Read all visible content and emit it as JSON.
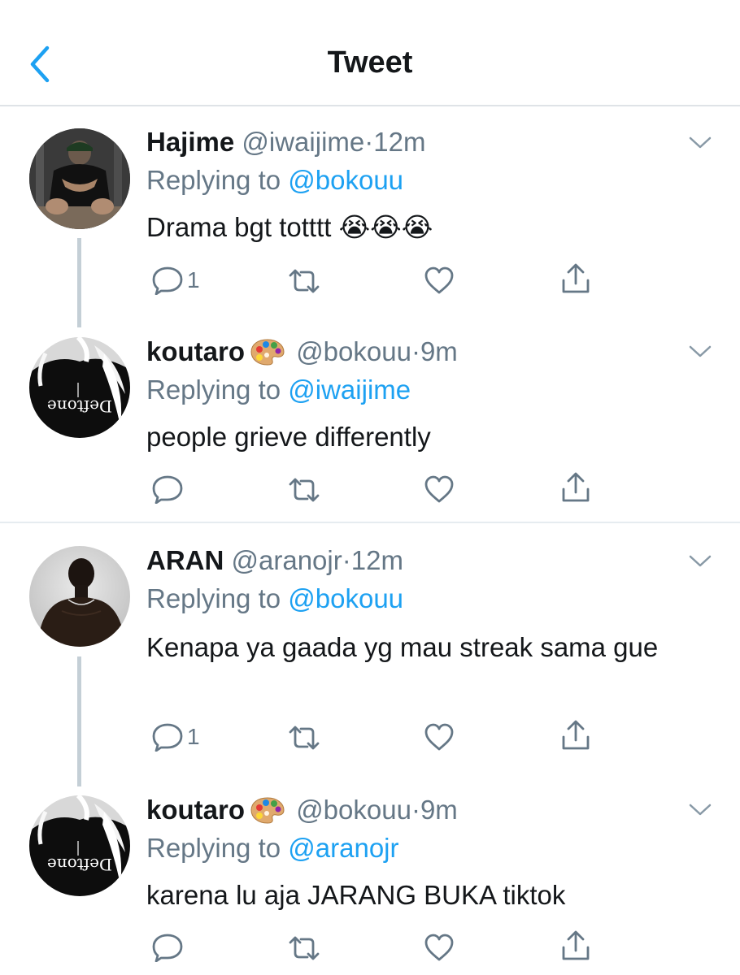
{
  "header": {
    "title": "Tweet",
    "back_icon": "chevron-left-icon"
  },
  "colors": {
    "accent": "#1da1f2",
    "secondary_text": "#657786",
    "thread_line": "#c4cfd6"
  },
  "tweets": [
    {
      "name": "Hajime",
      "handle": "@iwaijime",
      "separator": "·",
      "time": "12m",
      "replying_prefix": "Replying to ",
      "replying_to": "@bokouu",
      "text": "Drama bgt totttt 😭😭😭",
      "reply_count": "1"
    },
    {
      "name": "koutaro",
      "name_emoji": "🎨",
      "handle": "@bokouu",
      "separator": "·",
      "time": "9m",
      "replying_prefix": "Replying to ",
      "replying_to": "@iwaijime",
      "text": "people grieve differently",
      "reply_count": ""
    },
    {
      "name": "ARAN",
      "handle": "@aranojr",
      "separator": "·",
      "time": "12m",
      "replying_prefix": "Replying to ",
      "replying_to": "@bokouu",
      "text": "Kenapa ya gaada yg mau streak sama gue",
      "reply_count": "1"
    },
    {
      "name": "koutaro",
      "name_emoji": "🎨",
      "handle": "@bokouu",
      "separator": "·",
      "time": "9m",
      "replying_prefix": "Replying to ",
      "replying_to": "@aranojr",
      "text": "karena lu aja JARANG BUKA tiktok",
      "reply_count": ""
    }
  ]
}
